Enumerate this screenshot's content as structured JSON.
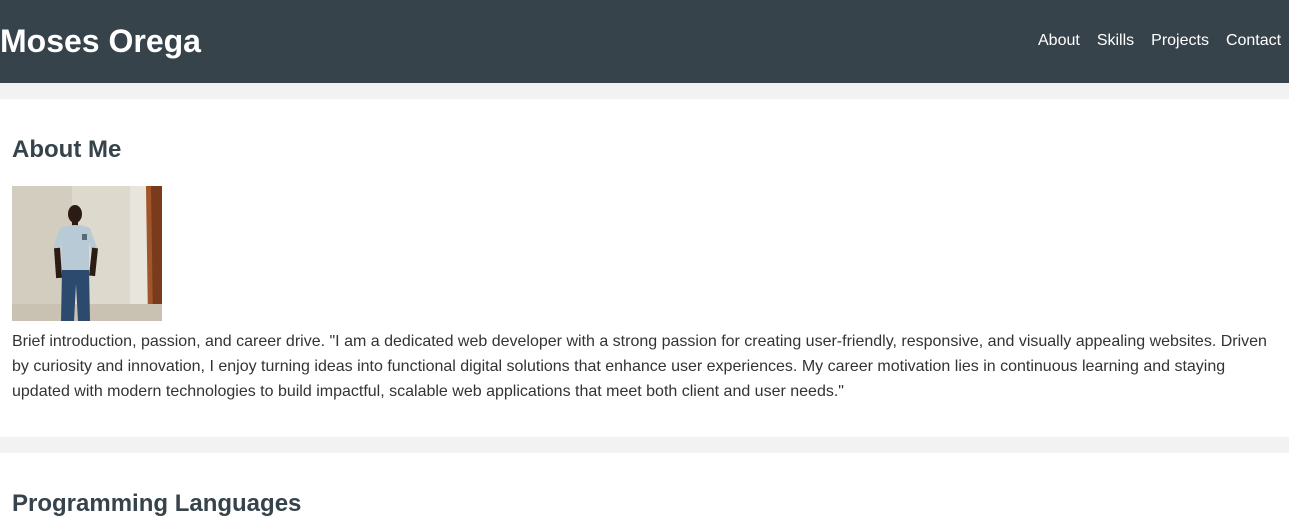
{
  "header": {
    "title": "Moses Orega",
    "nav": [
      "About",
      "Skills",
      "Projects",
      "Contact"
    ]
  },
  "about": {
    "heading": "About Me",
    "text": "Brief introduction, passion, and career drive. \"I am a dedicated web developer with a strong passion for creating user-friendly, responsive, and visually appealing websites. Driven by curiosity and innovation, I enjoy turning ideas into functional digital solutions that enhance user experiences. My career motivation lies in continuous learning and staying updated with modern technologies to build impactful, scalable web applications that meet both client and user needs.\""
  },
  "languages": {
    "heading": "Programming Languages"
  },
  "colors": {
    "header_bg": "#36434b",
    "page_bg": "#f2f2f2",
    "section_bg": "#ffffff",
    "heading": "#36434b"
  }
}
